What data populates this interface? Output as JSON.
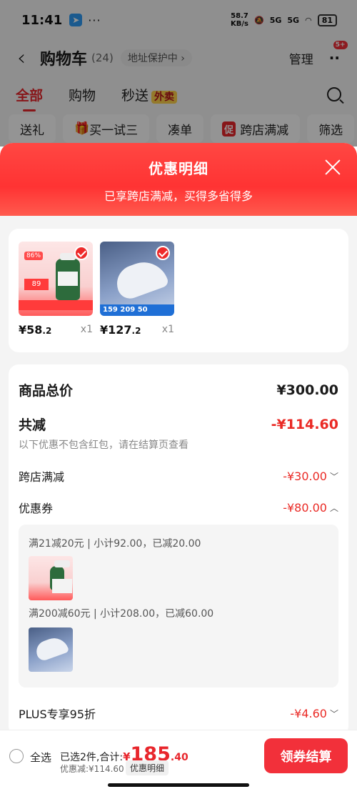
{
  "status_bar": {
    "time": "11:41",
    "dots": "···",
    "speed_top": "58.7",
    "speed_bottom": "KB/s",
    "signal1": "5G",
    "signal2": "5G",
    "battery": "81"
  },
  "nav": {
    "title": "购物车",
    "count": "(24)",
    "address_protect": "地址保护中 ›",
    "manage": "管理",
    "more_badge": "5+"
  },
  "tabs": [
    {
      "label": "全部"
    },
    {
      "label": "购物"
    },
    {
      "label": "秒送",
      "tag": "外卖"
    }
  ],
  "filters": [
    {
      "label": "送礼"
    },
    {
      "label": "买一试三"
    },
    {
      "label": "凑单"
    },
    {
      "label": "跨店满减",
      "icon_text": "促"
    },
    {
      "label": "筛选"
    }
  ],
  "sheet": {
    "title": "优惠明细",
    "subtitle": "已享跨店满减，买得多省得多"
  },
  "products": [
    {
      "price_main": "¥58",
      "price_decimal": ".2",
      "qty": "x1",
      "image": "supplement-bottle",
      "img_tag": "86%",
      "img_price": "89"
    },
    {
      "price_main": "¥127",
      "price_decimal": ".2",
      "qty": "x1",
      "image": "running-shoe",
      "img_band": "159 209 50"
    }
  ],
  "summary": {
    "total_label": "商品总价",
    "total_value": "¥300.00",
    "reduce_label": "共减",
    "reduce_value": "-¥114.60",
    "note": "以下优惠不包含红包，请在结算页查看",
    "cross_store_label": "跨店满减",
    "cross_store_value": "-¥30.00",
    "coupon_label": "优惠券",
    "coupon_value": "-¥80.00",
    "coupons": [
      {
        "text": "满21减20元 | 小计92.00，已减20.00",
        "image": "supplement-bottle"
      },
      {
        "text": "满200减60元 | 小计208.00，已减60.00",
        "image": "running-shoe"
      }
    ],
    "plus_label": "PLUS专享95折",
    "plus_value": "-¥4.60"
  },
  "bottom_bar": {
    "select_all": "全选",
    "selected_text": "已选2件,合计:",
    "yen": "¥",
    "total_int": "185",
    "total_dec": ".40",
    "discount_text": "优惠减:¥114.60",
    "detail_tag": "优惠明细",
    "checkout": "领券结算"
  },
  "colors": {
    "accent": "#f2303a",
    "price_red": "#ea2a25"
  }
}
